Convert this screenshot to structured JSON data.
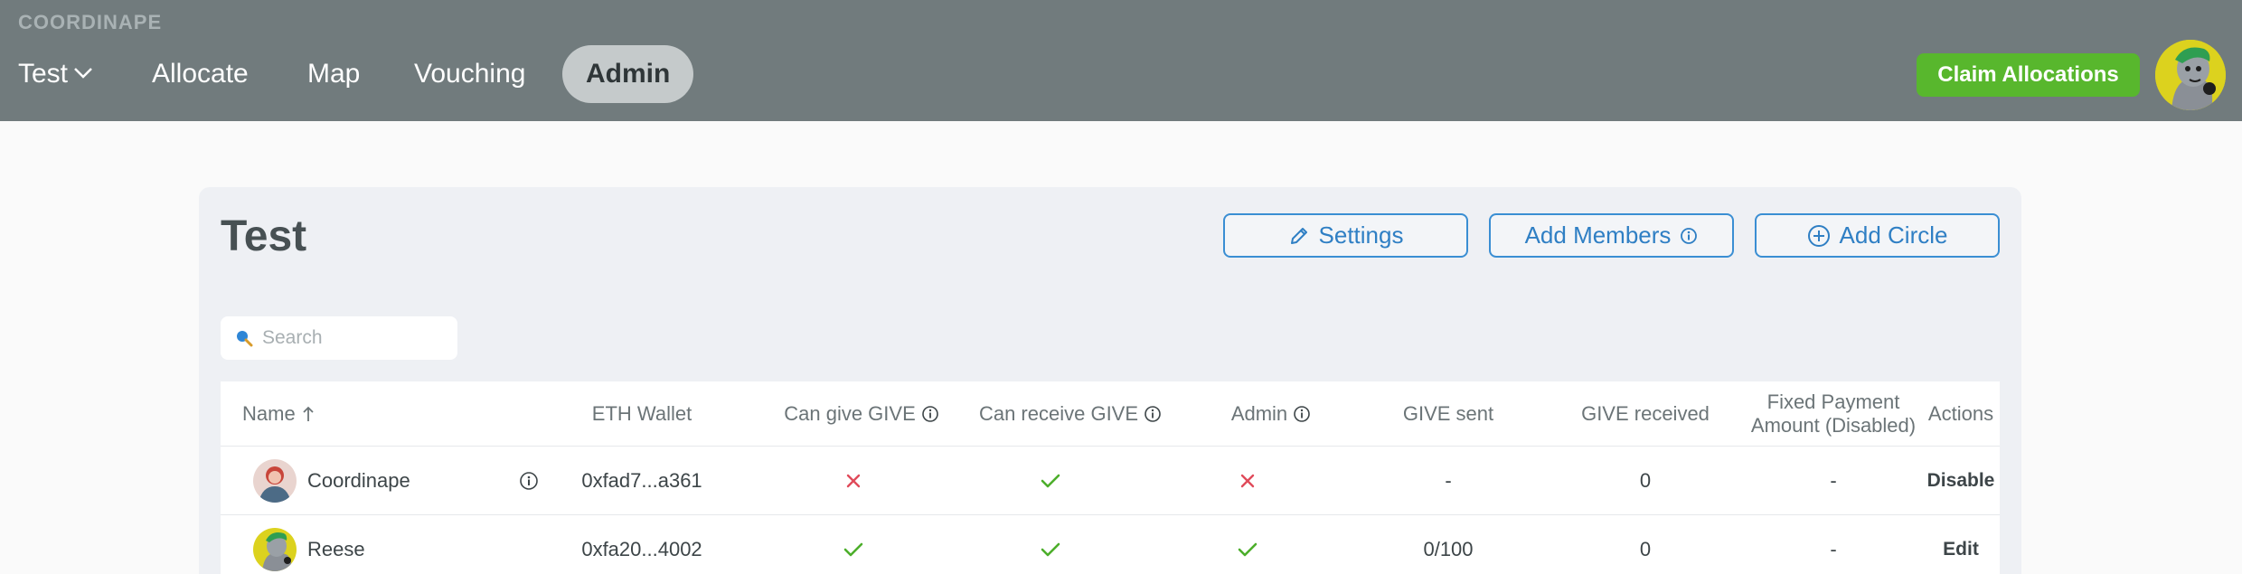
{
  "header": {
    "logo": "COORDINAPE",
    "circle_selector": "Test",
    "nav": [
      "Allocate",
      "Map",
      "Vouching",
      "Admin"
    ],
    "active_nav": "Admin",
    "claim_label": "Claim Allocations"
  },
  "colors": {
    "header_bg": "#717b7d",
    "accent_blue": "#3a8ed3",
    "claim_green": "#58b72d",
    "check_green": "#4cae2b",
    "cross_red": "#e04b5a"
  },
  "page": {
    "title": "Test",
    "settings_label": "Settings",
    "add_members_label": "Add Members",
    "add_circle_label": "Add Circle",
    "search_placeholder": "Search"
  },
  "table": {
    "columns": {
      "name": "Name",
      "wallet": "ETH Wallet",
      "can_give": "Can give GIVE",
      "can_receive": "Can receive GIVE",
      "admin": "Admin",
      "give_sent": "GIVE sent",
      "give_received": "GIVE received",
      "fixed_payment_1": "Fixed Payment",
      "fixed_payment_2": "Amount (Disabled)",
      "actions": "Actions"
    },
    "rows": [
      {
        "name": "Coordinape",
        "wallet": "0xfad7...a361",
        "can_give": false,
        "can_receive": true,
        "admin": false,
        "give_sent": "-",
        "give_received": "0",
        "fixed_payment": "-",
        "action": "Disable"
      },
      {
        "name": "Reese",
        "wallet": "0xfa20...4002",
        "can_give": true,
        "can_receive": true,
        "admin": true,
        "give_sent": "0/100",
        "give_received": "0",
        "fixed_payment": "-",
        "action": "Edit"
      }
    ]
  }
}
